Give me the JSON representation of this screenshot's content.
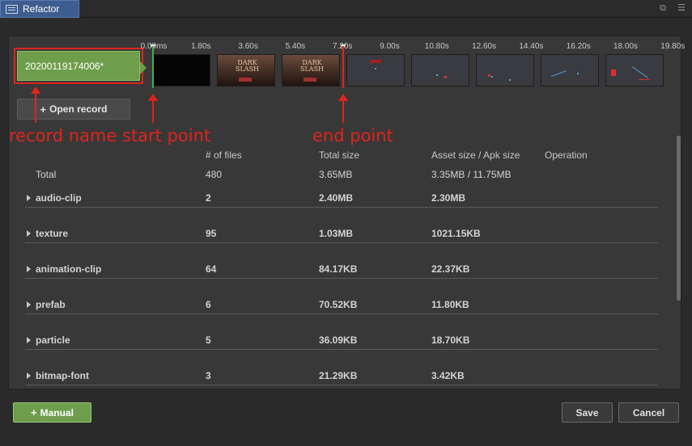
{
  "window": {
    "tab_title": "Refactor",
    "restore_glyph": "⧉",
    "menu_glyph": "☰"
  },
  "record": {
    "name": "20200119174006*",
    "open_label": "Open record",
    "plus_glyph": "+"
  },
  "timeline": {
    "ticks": [
      "0.00ms",
      "1.80s",
      "3.60s",
      "5.40s",
      "7.20s",
      "9.00s",
      "10.80s",
      "12.60s",
      "14.40s",
      "16.20s",
      "18.00s",
      "19.80s"
    ],
    "frame_title": "DARK\nSLASH"
  },
  "annotations": {
    "record_name": "record name",
    "start_point": "start point",
    "end_point": "end point"
  },
  "table": {
    "headers": {
      "files": "# of files",
      "total_size": "Total size",
      "asset_apk": "Asset size / Apk size",
      "operation": "Operation"
    },
    "total": {
      "label": "Total",
      "files": "480",
      "total_size": "3.65MB",
      "asset_apk": "3.35MB / 11.75MB"
    },
    "rows": [
      {
        "name": "audio-clip",
        "files": "2",
        "total_size": "2.40MB",
        "asset_size": "2.30MB"
      },
      {
        "name": "texture",
        "files": "95",
        "total_size": "1.03MB",
        "asset_size": "1021.15KB"
      },
      {
        "name": "animation-clip",
        "files": "64",
        "total_size": "84.17KB",
        "asset_size": "22.37KB"
      },
      {
        "name": "prefab",
        "files": "6",
        "total_size": "70.52KB",
        "asset_size": "11.80KB"
      },
      {
        "name": "particle",
        "files": "5",
        "total_size": "36.09KB",
        "asset_size": "18.70KB"
      },
      {
        "name": "bitmap-font",
        "files": "3",
        "total_size": "21.29KB",
        "asset_size": "3.42KB"
      }
    ]
  },
  "footer": {
    "manual_label": "Manual",
    "save_label": "Save",
    "cancel_label": "Cancel"
  },
  "colors": {
    "accent_green": "#6e9e4c",
    "annotation_red": "#e0241c",
    "tab_blue": "#3d5c8f"
  }
}
